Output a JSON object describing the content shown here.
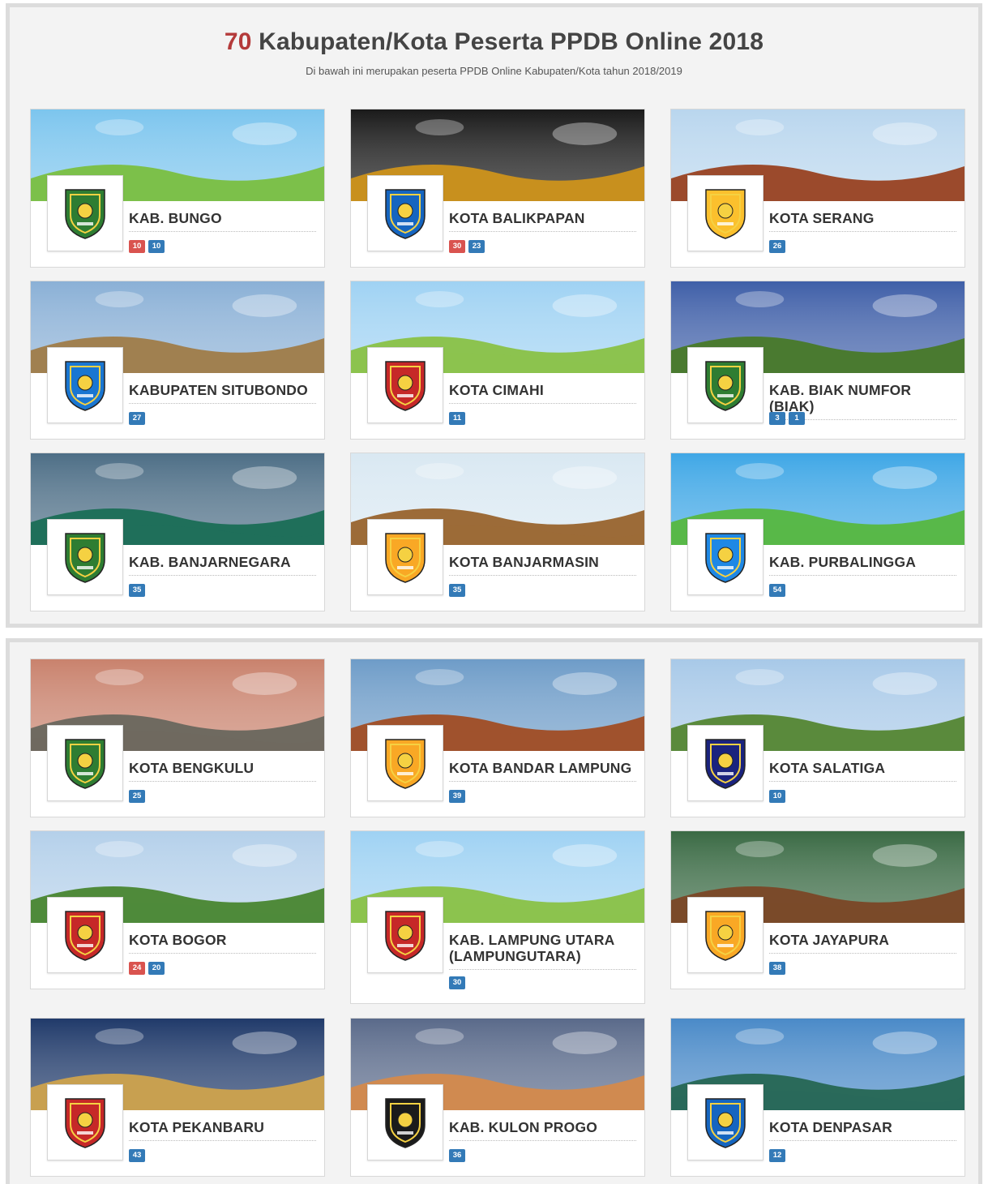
{
  "header": {
    "count": "70",
    "title": "Kabupaten/Kota Peserta PPDB Online 2018",
    "subtitle": "Di bawah ini merupakan peserta PPDB Online Kabupaten/Kota tahun 2018/2019"
  },
  "cards": [
    {
      "name": "KAB. BUNGO",
      "badges": [
        {
          "value": "10",
          "color": "red"
        },
        {
          "value": "10",
          "color": "blue"
        }
      ],
      "banner_sky": "#7cc5ee",
      "banner_ground": "#7cc04a",
      "logo_color": "#2e7d32"
    },
    {
      "name": "KOTA BALIKPAPAN",
      "badges": [
        {
          "value": "30",
          "color": "red"
        },
        {
          "value": "23",
          "color": "blue"
        }
      ],
      "banner_sky": "#1a1a1a",
      "banner_ground": "#c8901e",
      "logo_color": "#1565c0"
    },
    {
      "name": "KOTA SERANG",
      "badges": [
        {
          "value": "26",
          "color": "blue"
        }
      ],
      "banner_sky": "#b9d6ee",
      "banner_ground": "#9b4a2c",
      "logo_color": "#fbc02d"
    },
    {
      "name": "KABUPATEN SITUBONDO",
      "badges": [
        {
          "value": "27",
          "color": "blue"
        }
      ],
      "banner_sky": "#8ab0d6",
      "banner_ground": "#a08050",
      "logo_color": "#1976d2"
    },
    {
      "name": "KOTA CIMAHI",
      "badges": [
        {
          "value": "11",
          "color": "blue"
        }
      ],
      "banner_sky": "#9fd2f3",
      "banner_ground": "#8cc34f",
      "logo_color": "#c62828"
    },
    {
      "name": "KAB. BIAK NUMFOR (BIAK)",
      "badges": [
        {
          "value": "3",
          "color": "blue"
        },
        {
          "value": "1",
          "color": "blue"
        }
      ],
      "banner_sky": "#3f5fa8",
      "banner_ground": "#4a7a30",
      "logo_color": "#2e7d32"
    },
    {
      "name": "KAB. BANJARNEGARA",
      "badges": [
        {
          "value": "35",
          "color": "blue"
        }
      ],
      "banner_sky": "#4d6e86",
      "banner_ground": "#1f6f5a",
      "logo_color": "#2e7d32"
    },
    {
      "name": "KOTA BANJARMASIN",
      "badges": [
        {
          "value": "35",
          "color": "blue"
        }
      ],
      "banner_sky": "#d9e8f2",
      "banner_ground": "#9c6b38",
      "logo_color": "#f9a825"
    },
    {
      "name": "KAB. PURBALINGGA",
      "badges": [
        {
          "value": "54",
          "color": "blue"
        }
      ],
      "banner_sky": "#3fa7e6",
      "banner_ground": "#58b849",
      "logo_color": "#1e88e5"
    },
    {
      "name": "KOTA BENGKULU",
      "badges": [
        {
          "value": "25",
          "color": "blue"
        }
      ],
      "banner_sky": "#c9826d",
      "banner_ground": "#6f6a60",
      "logo_color": "#2e7d32"
    },
    {
      "name": "KOTA BANDAR LAMPUNG",
      "badges": [
        {
          "value": "39",
          "color": "blue"
        }
      ],
      "banner_sky": "#6e9cc8",
      "banner_ground": "#a0522d",
      "logo_color": "#f9a825"
    },
    {
      "name": "KOTA SALATIGA",
      "badges": [
        {
          "value": "10",
          "color": "blue"
        }
      ],
      "banner_sky": "#a8c9e8",
      "banner_ground": "#5a8a3c",
      "logo_color": "#1a237e"
    },
    {
      "name": "KOTA BOGOR",
      "badges": [
        {
          "value": "24",
          "color": "red"
        },
        {
          "value": "20",
          "color": "blue"
        }
      ],
      "banner_sky": "#b4d0ea",
      "banner_ground": "#4f8a3a",
      "logo_color": "#c62828"
    },
    {
      "name": "KAB. LAMPUNG UTARA (LAMPUNGUTARA)",
      "badges": [
        {
          "value": "30",
          "color": "blue"
        }
      ],
      "banner_sky": "#9fd2f3",
      "banner_ground": "#8cc34f",
      "logo_color": "#c62828"
    },
    {
      "name": "KOTA JAYAPURA",
      "badges": [
        {
          "value": "38",
          "color": "blue"
        }
      ],
      "banner_sky": "#3a6a44",
      "banner_ground": "#7a4a2a",
      "logo_color": "#f9a825"
    },
    {
      "name": "KOTA PEKANBARU",
      "badges": [
        {
          "value": "43",
          "color": "blue"
        }
      ],
      "banner_sky": "#203a6a",
      "banner_ground": "#c8a050",
      "logo_color": "#c62828"
    },
    {
      "name": "KAB. KULON PROGO",
      "badges": [
        {
          "value": "36",
          "color": "blue"
        }
      ],
      "banner_sky": "#5a6a8a",
      "banner_ground": "#d08a50",
      "logo_color": "#1b1b1b"
    },
    {
      "name": "KOTA DENPASAR",
      "badges": [
        {
          "value": "12",
          "color": "blue"
        }
      ],
      "banner_sky": "#4a8ac8",
      "banner_ground": "#2a6a5a",
      "logo_color": "#1565c0"
    }
  ]
}
